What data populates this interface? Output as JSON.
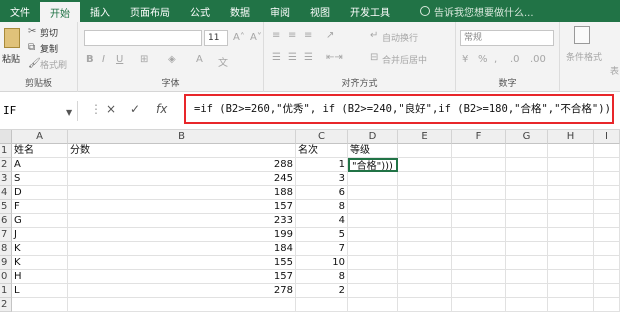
{
  "tabs": [
    "文件",
    "开始",
    "插入",
    "页面布局",
    "公式",
    "数据",
    "审阅",
    "视图",
    "开发工具"
  ],
  "active_tab_index": 1,
  "tell_me": "告诉我您想要做什么...",
  "ribbon": {
    "clipboard": {
      "paste": "粘贴",
      "cut": "剪切",
      "copy": "复制",
      "format_painter": "格式刷",
      "label": "剪贴板"
    },
    "font": {
      "size": "11",
      "label": "字体"
    },
    "alignment": {
      "wrap": "自动换行",
      "merge": "合并后居中",
      "label": "对齐方式"
    },
    "number": {
      "format": "常规",
      "label": "数字"
    },
    "styles": {
      "conditional": "条件格式",
      "table": "表"
    }
  },
  "formula_bar": {
    "name_box": "IF",
    "cancel": "×",
    "enter": "✓",
    "fx": "fx",
    "formula": "=if (B2>=260,\"优秀\", if (B2>=240,\"良好\",if (B2>=180,\"合格\",\"不合格\")))"
  },
  "columns": [
    "A",
    "B",
    "C",
    "D",
    "E",
    "F",
    "G",
    "H",
    "I"
  ],
  "row_numbers": [
    "1",
    "2",
    "3",
    "4",
    "5",
    "6",
    "7",
    "8",
    "9",
    "0",
    "1",
    "2"
  ],
  "headers": {
    "a": "姓名",
    "b": "分数",
    "c": "名次",
    "d": "等级"
  },
  "d2_overflow": "\"合格\")))",
  "rows": [
    {
      "name": "A",
      "score": "288",
      "rank": "1"
    },
    {
      "name": "S",
      "score": "245",
      "rank": "3"
    },
    {
      "name": "D",
      "score": "188",
      "rank": "6"
    },
    {
      "name": "F",
      "score": "157",
      "rank": "8"
    },
    {
      "name": "G",
      "score": "233",
      "rank": "4"
    },
    {
      "name": "J",
      "score": "199",
      "rank": "5"
    },
    {
      "name": "K",
      "score": "184",
      "rank": "7"
    },
    {
      "name": "K",
      "score": "155",
      "rank": "10"
    },
    {
      "name": "H",
      "score": "157",
      "rank": "8"
    },
    {
      "name": "L",
      "score": "278",
      "rank": "2"
    }
  ],
  "colors": {
    "brand": "#217346",
    "highlight": "#e8262a"
  }
}
